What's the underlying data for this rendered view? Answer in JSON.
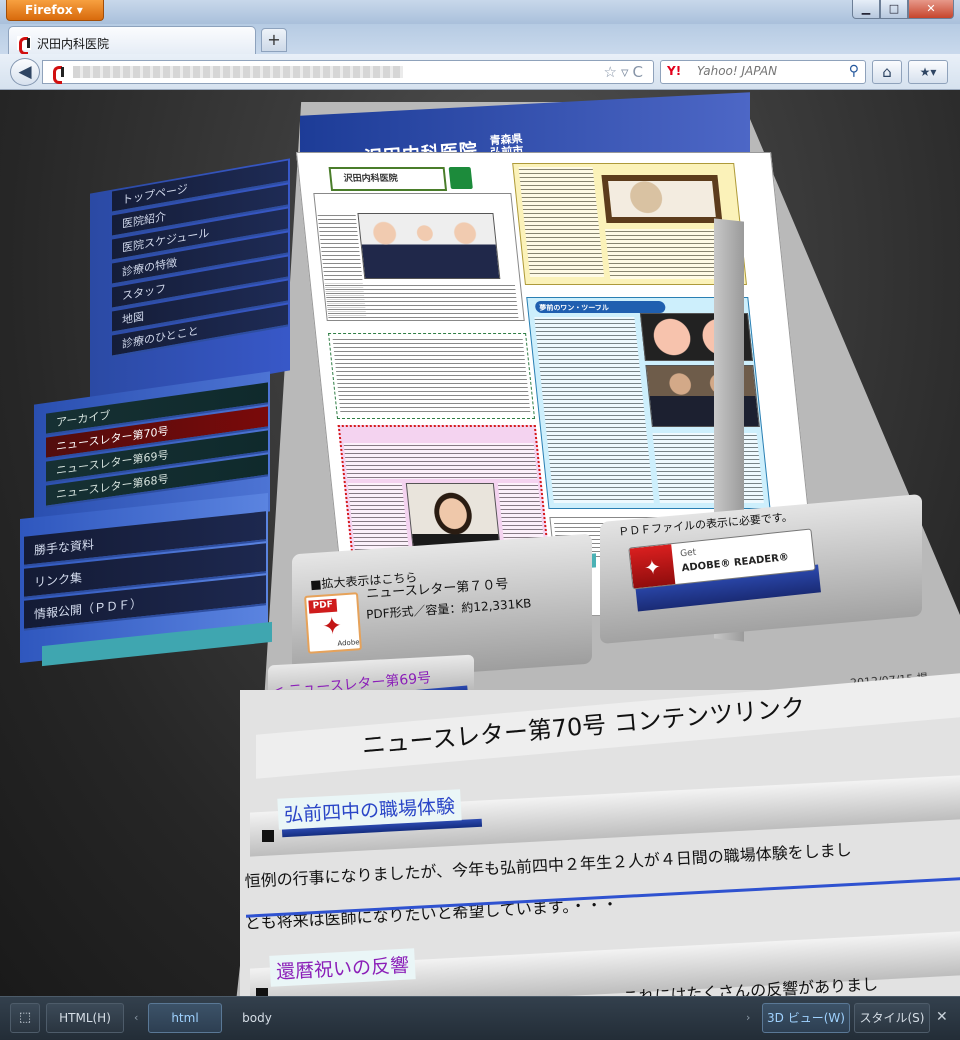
{
  "browser": {
    "menu_label": "Firefox ▾",
    "window_controls": {
      "minimize": "▁",
      "maximize": "□",
      "close": "✕"
    },
    "tab_title": "沢田内科医院",
    "new_tab": "+",
    "nav": {
      "back": "◀",
      "url_controls": "☆▿C",
      "search_engine": "Y!",
      "search_placeholder": "Yahoo! JAPAN",
      "search_go": "⚲",
      "home": "⌂",
      "bookmarks": "★▾"
    }
  },
  "site": {
    "title": "沢田内科医院",
    "place": "青森県 弘前市"
  },
  "sidebar": {
    "top_menu": [
      "トップページ",
      "医院紹介",
      "医院スケジュール",
      "診療の特徴",
      "スタッフ",
      "地図",
      "診療のひとこと"
    ],
    "archive_menu": [
      {
        "label": "アーカイブ",
        "selected": false
      },
      {
        "label": "ニュースレター第70号",
        "selected": true
      },
      {
        "label": "ニュースレター第69号",
        "selected": false
      },
      {
        "label": "ニュースレター第68号",
        "selected": false
      }
    ],
    "bottom_menu": [
      "勝手な資料",
      "リンク集",
      "情報公開（ＰＤＦ）"
    ]
  },
  "newsletter": {
    "logo_text": "沢田内科医院",
    "reader_ribbon": "夢前のワン・ツーフル"
  },
  "pdf": {
    "bullet_label": "■拡大表示はこちら",
    "icon_tab": "PDF",
    "icon_adobe": "Adobe",
    "file_name": "ニュースレター第７０号",
    "file_info": "PDF形式／容量：約12,331KB"
  },
  "reader": {
    "note": "ＰＤＦファイルの表示に必要です。",
    "get": "Get",
    "label": "ADOBE® READER®"
  },
  "navigation": {
    "prev_issue": "< ニュースレター第69号",
    "date": "2012/07/15 掲"
  },
  "content": {
    "title": "ニュースレター第70号 コンテンツリンク",
    "articles": [
      {
        "title": "弘前四中の職場体験",
        "lead": "今年も弘前四中２年生２人が４日間の職場体験をしまし",
        "body_1": "恒例の行事になりましたが、今年も弘前四中２年生２人が４日間の職場体験をしまし",
        "body_2": "とも将来は医師になりたいと希望しています。・・・"
      },
      {
        "title": "還暦祝いの反響",
        "body_1": "これにはたくさんの反響がありまし"
      }
    ]
  },
  "devtools": {
    "inspect": "⬚",
    "html_button": "HTML(H)",
    "crumb_left": "‹",
    "crumb_html": "html",
    "crumb_body": "body",
    "crumb_right": "›",
    "view_3d": "3D ビュー(W)",
    "style": "スタイル(S)",
    "close": "✕"
  },
  "colors": {
    "menu_dark": "#151d38",
    "menu_selected": "#7a0a0a",
    "link_blue": "#2a45c7",
    "link_purple": "#8b1fb8",
    "accent_teal": "#4ab1b5"
  }
}
